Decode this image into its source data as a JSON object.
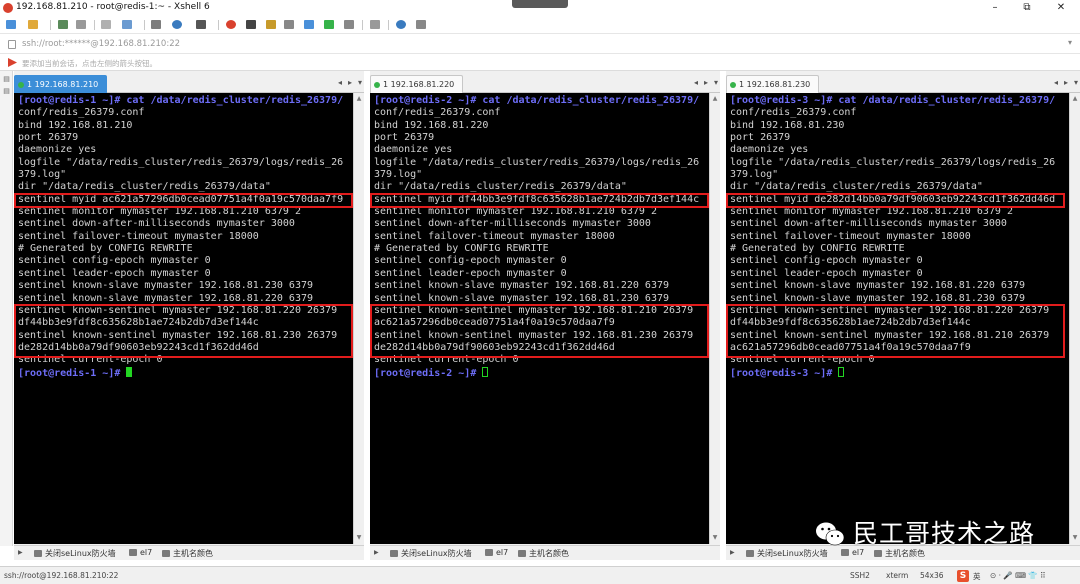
{
  "window": {
    "title": "192.168.81.210 - root@redis-1:~ - Xshell 6",
    "minimize": "–",
    "maximize": "⧉",
    "close": "✕"
  },
  "address_bar": {
    "value": "ssh://root:******@192.168.81.210:22",
    "dropdown": "▾"
  },
  "hint_bar": {
    "text": "要添加当前会话，点击左侧的箭头按钮。"
  },
  "panes": [
    {
      "tab_label": "1 192.168.81.210",
      "prompt": "[root@redis-1 ~]# ",
      "cursor": "solid",
      "lines": [
        "[root@redis-1 ~]# cat /data/redis_cluster/redis_26379/",
        "conf/redis_26379.conf",
        "bind 192.168.81.210",
        "port 26379",
        "daemonize yes",
        "logfile \"/data/redis_cluster/redis_26379/logs/redis_26",
        "379.log\"",
        "dir \"/data/redis_cluster/redis_26379/data\"",
        "sentinel myid ac621a57296db0cead07751a4f0a19c570daa7f9",
        "sentinel monitor mymaster 192.168.81.210 6379 2",
        "sentinel down-after-milliseconds mymaster 3000",
        "sentinel failover-timeout mymaster 18000",
        "# Generated by CONFIG REWRITE",
        "sentinel config-epoch mymaster 0",
        "sentinel leader-epoch mymaster 0",
        "sentinel known-slave mymaster 192.168.81.230 6379",
        "sentinel known-slave mymaster 192.168.81.220 6379",
        "sentinel known-sentinel mymaster 192.168.81.220 26379",
        "df44bb3e9fdf8c635628b1ae724b2db7d3ef144c",
        "sentinel known-sentinel mymaster 192.168.81.230 26379",
        "de282d14bb0a79df90603eb92243cd1f362dd46d",
        "sentinel current-epoch 0"
      ],
      "footer": {
        "firewall": "关闭seLinux防火墙",
        "el7": "el7",
        "hostcolor": "主机名颜色"
      }
    },
    {
      "tab_label": "1 192.168.81.220",
      "prompt": "[root@redis-2 ~]# ",
      "cursor": "hollow",
      "lines": [
        "[root@redis-2 ~]# cat /data/redis_cluster/redis_26379/",
        "conf/redis_26379.conf",
        "bind 192.168.81.220",
        "port 26379",
        "daemonize yes",
        "logfile \"/data/redis_cluster/redis_26379/logs/redis_26",
        "379.log\"",
        "dir \"/data/redis_cluster/redis_26379/data\"",
        "sentinel myid df44bb3e9fdf8c635628b1ae724b2db7d3ef144c",
        "sentinel monitor mymaster 192.168.81.210 6379 2",
        "sentinel down-after-milliseconds mymaster 3000",
        "sentinel failover-timeout mymaster 18000",
        "# Generated by CONFIG REWRITE",
        "sentinel config-epoch mymaster 0",
        "sentinel leader-epoch mymaster 0",
        "sentinel known-slave mymaster 192.168.81.220 6379",
        "sentinel known-slave mymaster 192.168.81.230 6379",
        "sentinel known-sentinel mymaster 192.168.81.210 26379",
        "ac621a57296db0cead07751a4f0a19c570daa7f9",
        "sentinel known-sentinel mymaster 192.168.81.230 26379",
        "de282d14bb0a79df90603eb92243cd1f362dd46d",
        "sentinel current-epoch 0"
      ],
      "footer": {
        "firewall": "关闭seLinux防火墙",
        "el7": "el7",
        "hostcolor": "主机名颜色"
      }
    },
    {
      "tab_label": "1 192.168.81.230",
      "prompt": "[root@redis-3 ~]# ",
      "cursor": "hollow",
      "lines": [
        "[root@redis-3 ~]# cat /data/redis_cluster/redis_26379/",
        "conf/redis_26379.conf",
        "bind 192.168.81.230",
        "port 26379",
        "daemonize yes",
        "logfile \"/data/redis_cluster/redis_26379/logs/redis_26",
        "379.log\"",
        "dir \"/data/redis_cluster/redis_26379/data\"",
        "sentinel myid de282d14bb0a79df90603eb92243cd1f362dd46d",
        "sentinel monitor mymaster 192.168.81.210 6379 2",
        "sentinel down-after-milliseconds mymaster 3000",
        "sentinel failover-timeout mymaster 18000",
        "# Generated by CONFIG REWRITE",
        "sentinel config-epoch mymaster 0",
        "sentinel leader-epoch mymaster 0",
        "sentinel known-slave mymaster 192.168.81.220 6379",
        "sentinel known-slave mymaster 192.168.81.230 6379",
        "sentinel known-sentinel mymaster 192.168.81.220 26379",
        "df44bb3e9fdf8c635628b1ae724b2db7d3ef144c",
        "sentinel known-sentinel mymaster 192.168.81.210 26379",
        "ac621a57296db0cead07751a4f0a19c570daa7f9",
        "sentinel current-epoch 0"
      ],
      "footer": {
        "firewall": "关闭seLinux防火墙",
        "el7": "el7",
        "hostcolor": "主机名颜色"
      }
    }
  ],
  "status_bar": {
    "connection": "ssh://root@192.168.81.210:22",
    "protocol": "SSH2",
    "terminal": "xterm",
    "size": "54x36",
    "ime": "S",
    "ime_lang": "英",
    "extra": "⊙ · 🎤 ⌨ 👕 ⠿"
  },
  "watermark": {
    "text": "民工哥技术之路"
  },
  "colors": {
    "accent": "#3c8ed8",
    "highlight": "#e21c1c",
    "prompt": "#6d6df7",
    "cursor": "#22d622"
  }
}
